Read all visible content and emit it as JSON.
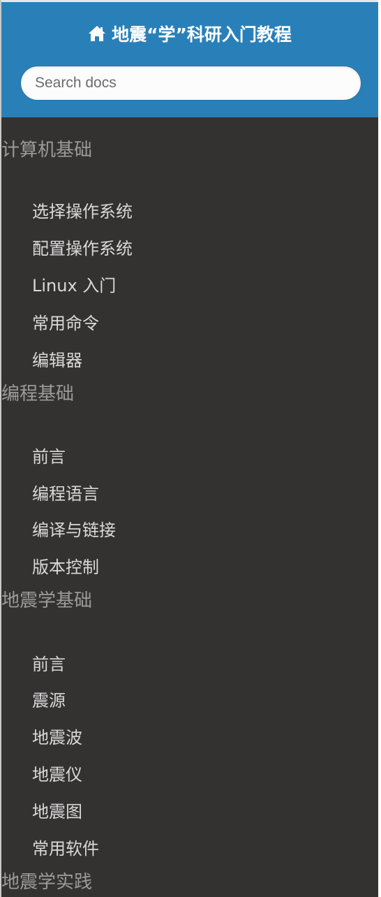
{
  "header": {
    "title": "地震“学”科研入门教程",
    "icon": "home-icon"
  },
  "search": {
    "placeholder": "Search docs"
  },
  "colors": {
    "header_bg": "#2980b9",
    "sidebar_bg": "#343131",
    "caption_text": "#9b9b9b",
    "item_text": "#d9d9d9"
  },
  "nav": {
    "sections": [
      {
        "caption": "计算机基础",
        "items": [
          "选择操作系统",
          "配置操作系统",
          "Linux 入门",
          "常用命令",
          "编辑器"
        ]
      },
      {
        "caption": "编程基础",
        "items": [
          "前言",
          "编程语言",
          "编译与链接",
          "版本控制"
        ]
      },
      {
        "caption": "地震学基础",
        "items": [
          "前言",
          "震源",
          "地震波",
          "地震仪",
          "地震图",
          "常用软件"
        ]
      },
      {
        "caption": "地震学实践",
        "items": []
      }
    ]
  }
}
